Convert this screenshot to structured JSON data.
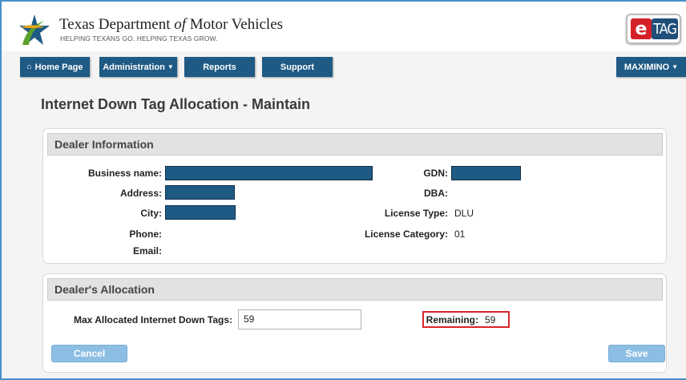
{
  "header": {
    "title_pre": "Texas Department ",
    "title_of": "of",
    "title_post": " Motor Vehicles",
    "tagline": "HELPING TEXANS GO. HELPING TEXAS GROW.",
    "etag_e": "e",
    "etag_tag": "TAG",
    "star_icon": "texas-star-logo-icon"
  },
  "nav": {
    "home_glyph": "⌂",
    "home": "Home Page",
    "administration": "Administration",
    "reports": "Reports",
    "support": "Support",
    "user": "MAXIMINO",
    "caret": "▼"
  },
  "page_title": "Internet Down Tag Allocation - Maintain",
  "dealer": {
    "heading": "Dealer Information",
    "business_name_label": "Business name:",
    "address_label": "Address:",
    "city_label": "City:",
    "phone_label": "Phone:",
    "email_label": "Email:",
    "gdn_label": "GDN:",
    "dba_label": "DBA:",
    "license_type_label": "License Type:",
    "license_type": "DLU",
    "license_category_label": "License Category:",
    "license_category": "01"
  },
  "allocation": {
    "heading": "Dealer's Allocation",
    "max_label": "Max Allocated Internet Down Tags:",
    "max_value": "59",
    "remaining_label": "Remaining:",
    "remaining_value": "59"
  },
  "buttons": {
    "cancel": "Cancel",
    "save": "Save"
  },
  "colors": {
    "nav": "#1f5a85",
    "light_button": "#8cbde3",
    "highlight": "#d6262b",
    "redaction": "#1f5a85"
  }
}
